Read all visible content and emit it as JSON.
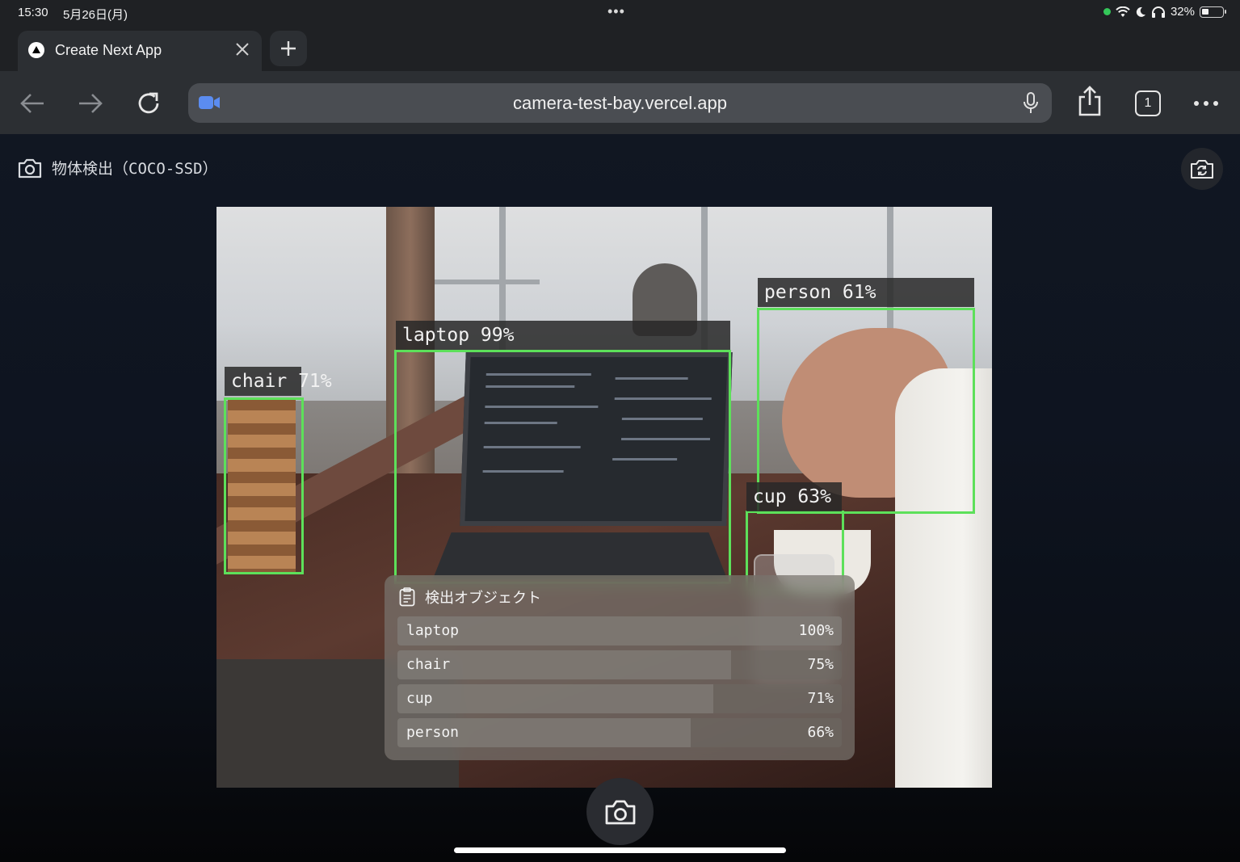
{
  "status_bar": {
    "time": "15:30",
    "date": "5月26日(月)",
    "battery": "32%",
    "battery_level": 0.32
  },
  "browser": {
    "tab_title": "Create Next App",
    "url": "camera-test-bay.vercel.app",
    "tab_count": "1"
  },
  "page": {
    "title": "物体検出（COCO-SSD）"
  },
  "detections": [
    {
      "label": "chair 71%"
    },
    {
      "label": "laptop 99%"
    },
    {
      "label": "person 61%"
    },
    {
      "label": "cup 63%"
    }
  ],
  "objects_panel": {
    "title": "検出オブジェクト",
    "items": [
      {
        "name": "laptop",
        "score": "100%",
        "level": 1.0
      },
      {
        "name": "chair",
        "score": "75%",
        "level": 0.75
      },
      {
        "name": "cup",
        "score": "71%",
        "level": 0.71
      },
      {
        "name": "person",
        "score": "66%",
        "level": 0.66
      }
    ]
  },
  "colors": {
    "detection_box": "#5de05a",
    "status_dot": "#34c759"
  }
}
